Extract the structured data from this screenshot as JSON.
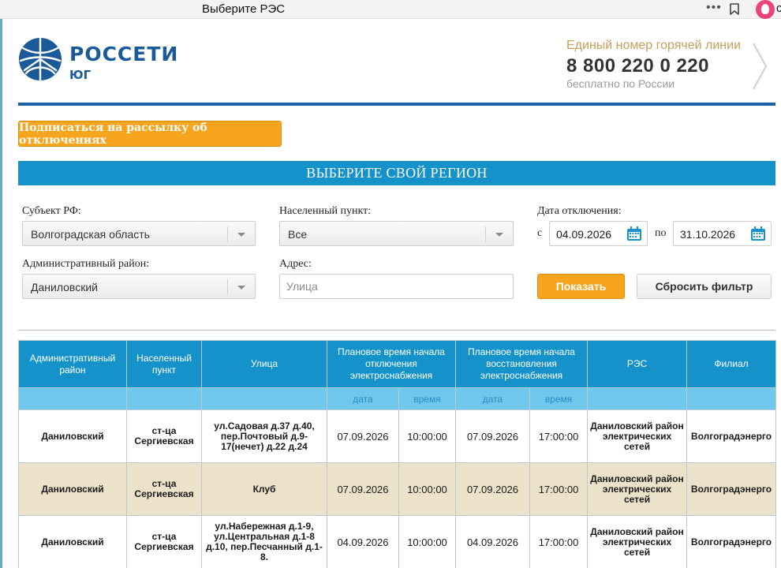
{
  "browser": {
    "tab_title": "Выберите РЭС",
    "more_label": "•••",
    "edge_glyph": "с"
  },
  "header": {
    "logo_name": "РОССЕТИ",
    "logo_sub": "ЮГ",
    "hotline_label": "Единый номер горячей линии",
    "hotline_number": "8 800 220 0 220",
    "hotline_note": "бесплатно по России"
  },
  "subscribe_label": "Подписаться на рассылку об отключениях",
  "region_title": "ВЫБЕРИТЕ СВОЙ РЕГИОН",
  "filters": {
    "subject_label": "Субъект РФ:",
    "subject_value": "Волгоградская область",
    "locality_label": "Населенный пункт:",
    "locality_value": "Все",
    "date_label": "Дата отключения:",
    "date_from_prefix": "с",
    "date_from": "04.09.2026",
    "date_to_prefix": "по",
    "date_to": "31.10.2026",
    "district_label": "Административный район:",
    "district_value": "Даниловский",
    "address_label": "Адрес:",
    "address_placeholder": "Улица",
    "show_label": "Показать",
    "reset_label": "Сбросить фильтр"
  },
  "table": {
    "headers": {
      "district": "Административный район",
      "locality": "Населенный пункт",
      "street": "Улица",
      "off_time": "Плановое время начала отключения электроснабжения",
      "on_time": "Плановое время начала восстановления электроснабжения",
      "res": "РЭС",
      "branch": "Филиал"
    },
    "sub": {
      "date": "дата",
      "time": "время"
    },
    "rows": [
      {
        "district": "Даниловский",
        "locality": "ст-ца Сергиевская",
        "street": "ул.Садовая д.37 д.40, пер.Почтовый д.9-17(нечет) д.22 д.24",
        "off_date": "07.09.2026",
        "off_time": "10:00:00",
        "on_date": "07.09.2026",
        "on_time": "17:00:00",
        "res": "Даниловский район электрических сетей",
        "branch": "Волгоградэнерго"
      },
      {
        "district": "Даниловский",
        "locality": "ст-ца Сергиевская",
        "street": "Клуб",
        "off_date": "07.09.2026",
        "off_time": "10:00:00",
        "on_date": "07.09.2026",
        "on_time": "17:00:00",
        "res": "Даниловский район электрических сетей",
        "branch": "Волгоградэнерго"
      },
      {
        "district": "Даниловский",
        "locality": "ст-ца Сергиевская",
        "street": "ул.Набережная д.1-9, ул.Центральная д.1-8 д.10, пер.Песчанный д.1-8.",
        "off_date": "04.09.2026",
        "off_time": "10:00:00",
        "on_date": "04.09.2026",
        "on_time": "17:00:00",
        "res": "Даниловский район электрических сетей",
        "branch": "Волгоградэнерго"
      }
    ]
  },
  "colors": {
    "brand_blue": "#1a5a99",
    "header_bar": "#1692cb",
    "accent_orange": "#f7a51f",
    "row_alt": "#ece1c9"
  },
  "icons": [
    "bookmark-icon",
    "profile-icon",
    "rosseti-logo-icon",
    "chevron-right-icon",
    "calendar-icon",
    "dropdown-caret-icon"
  ]
}
